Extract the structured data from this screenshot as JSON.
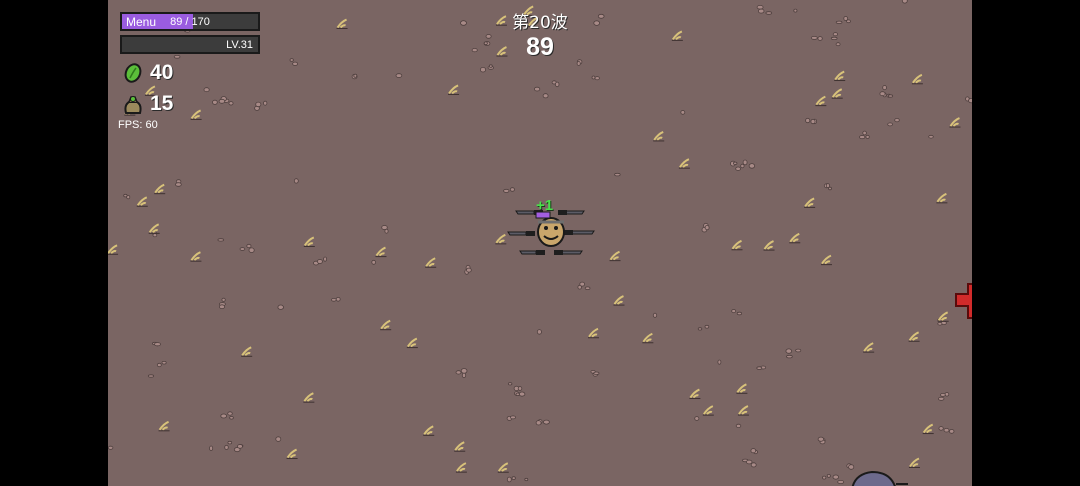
{
  "hud": {
    "menu_label": "Menu",
    "hp_text": "89 / 170",
    "hp_fraction": 0.52,
    "level_text": "LV.31",
    "xp_fraction": 0.0,
    "materials": "40",
    "bag_count": "15",
    "fps_text": "FPS: 60"
  },
  "wave": {
    "label": "第20波",
    "timer": "89"
  },
  "floating_text": "+1",
  "icons": {
    "materials": "green-material-icon",
    "bag": "loot-bag-icon",
    "player": "potato-player",
    "weapons": "knife-icon",
    "enemy_edge": "red-enemy",
    "enemy_bottom": "purple-enemy"
  },
  "colors": {
    "ground": "#7a6563",
    "hp": "#9a5ce0",
    "xp": "#66b14a",
    "enemy_red": "#d12b2b"
  }
}
